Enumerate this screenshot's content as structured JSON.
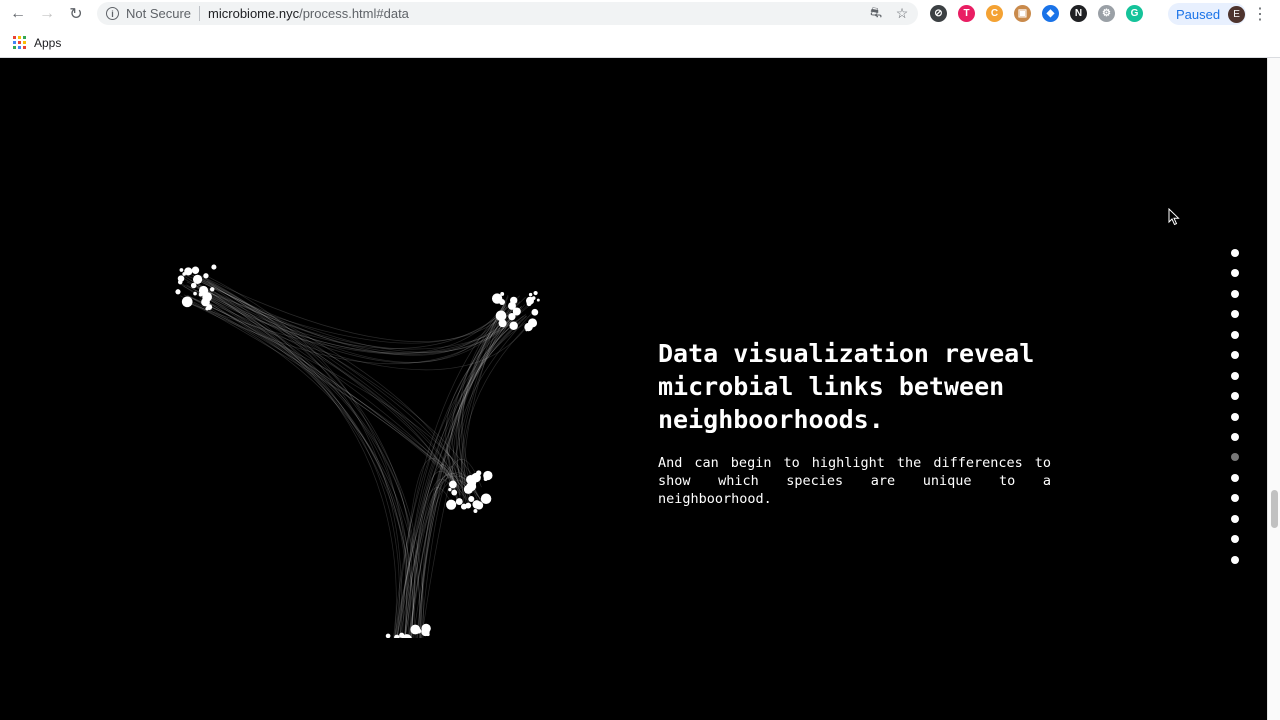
{
  "browser": {
    "security_label": "Not Secure",
    "url_host": "microbiome.nyc",
    "url_path": "/process.html#data",
    "profile_label": "Paused",
    "profile_initial": "E",
    "bookmarks": [
      {
        "label": "Apps"
      }
    ],
    "extensions": [
      {
        "name": "block-icon",
        "glyph": "⊘",
        "color": "#3c4043"
      },
      {
        "name": "t-extension-icon",
        "glyph": "T",
        "color": "#e91e63"
      },
      {
        "name": "c-extension-icon",
        "glyph": "C",
        "color": "#f4a233"
      },
      {
        "name": "box-extension-icon",
        "glyph": "▣",
        "color": "#c98a4b"
      },
      {
        "name": "grad-cap-icon",
        "glyph": "◆",
        "color": "#1a73e8"
      },
      {
        "name": "notion-icon",
        "glyph": "N",
        "color": "#202124"
      },
      {
        "name": "off-extension-icon",
        "glyph": "⚙",
        "color": "#9aa0a6"
      },
      {
        "name": "grammarly-icon",
        "glyph": "G",
        "color": "#15c39a"
      }
    ]
  },
  "content": {
    "headline": "Data visualization reveal microbial links between neighboorhoods.",
    "subtext": "And can begin to highlight the differences to show which species are unique to a neighboorhood."
  },
  "dot_nav": {
    "count": 16,
    "active_index": 10
  },
  "colors": {
    "page_background": "#000000",
    "text": "#ffffff",
    "dot_active": "#777777"
  }
}
